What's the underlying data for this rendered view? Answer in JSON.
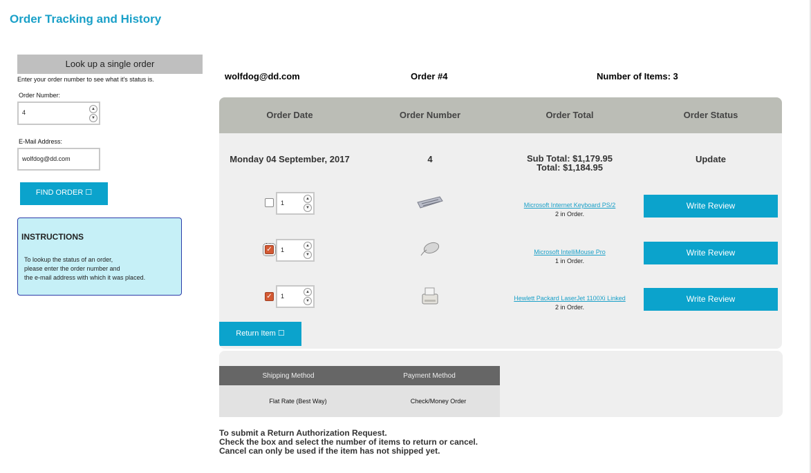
{
  "page": {
    "title": "Order Tracking and History"
  },
  "lookup": {
    "header": "Look up a single order",
    "help": "Enter your order number to see what it's status is.",
    "order_number_label": "Order Number:",
    "order_number_value": "4",
    "email_label": "E-Mail Address:",
    "email_value": "wolfdog@dd.com",
    "find_button": "FIND ORDER ☐"
  },
  "instructions": {
    "title": "INSTRUCTIONS",
    "lines": [
      "To lookup the status of an order,",
      "please enter the order number and",
      "the e-mail address with which it was placed."
    ]
  },
  "summary": {
    "email": "wolfdog@dd.com",
    "order": "Order #4",
    "items": "Number of Items: 3"
  },
  "order": {
    "headers": [
      "Order Date",
      "Order Number",
      "Order Total",
      "Order Status"
    ],
    "date": "Monday 04 September, 2017",
    "number": "4",
    "sub_total": "Sub Total: $1,179.95",
    "total": "Total: $1,184.95",
    "status": "Update",
    "items": [
      {
        "checked": false,
        "qty": "1",
        "icon": "keyboard-icon",
        "name": "Microsoft Internet Keyboard PS/2",
        "qty_text": "2 in Order.",
        "review_label": "Write Review"
      },
      {
        "checked": true,
        "qty": "1",
        "icon": "mouse-icon",
        "name": "Microsoft IntelliMouse Pro",
        "qty_text": "1 in Order.",
        "review_label": "Write Review"
      },
      {
        "checked": true,
        "qty": "1",
        "icon": "printer-icon",
        "name": "Hewlett Packard LaserJet 1100Xi Linked",
        "qty_text": "2 in Order.",
        "review_label": "Write Review"
      }
    ],
    "return_button": "Return Item ☐"
  },
  "shipping": {
    "headers": [
      "Shipping Method",
      "Payment Method"
    ],
    "values": [
      "Flat Rate (Best Way)",
      "Check/Money Order"
    ]
  },
  "footer": {
    "lines": [
      "To submit a Return Authorization Request.",
      "Check the box and select the number of items to return or cancel.",
      "Cancel can only be used if the item has not shipped yet."
    ]
  }
}
